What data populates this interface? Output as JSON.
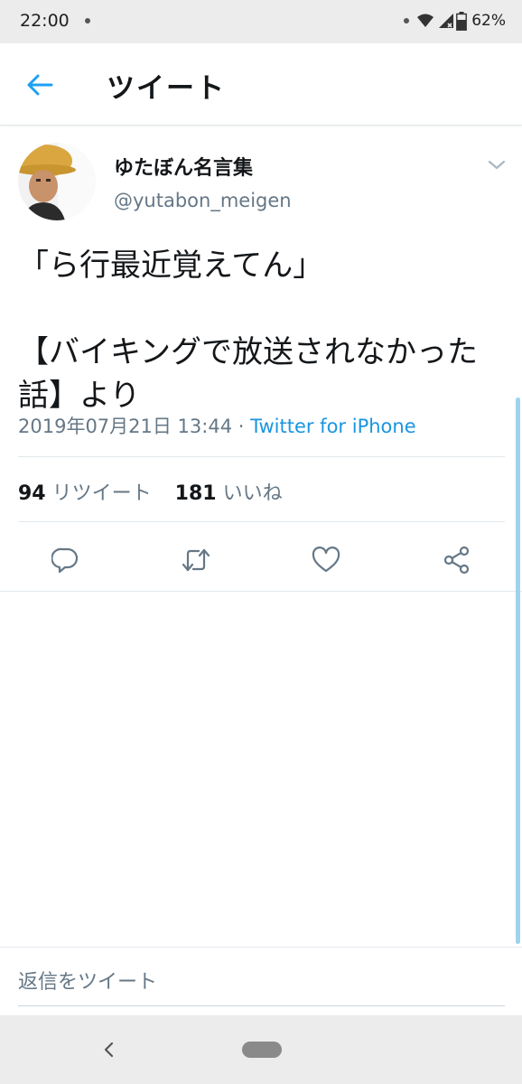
{
  "status_bar": {
    "time": "22:00",
    "battery": "62%",
    "icons": [
      "notification-dot-icon",
      "wifi-icon",
      "signal-icon",
      "battery-icon"
    ]
  },
  "header": {
    "title": "ツイート",
    "back_icon": "arrow-left-icon"
  },
  "tweet": {
    "display_name": "ゆたぼん名言集",
    "handle": "@yutabon_meigen",
    "text": "「ら行最近覚えてん」\n\n【バイキングで放送されなかった話】より",
    "timestamp": "2019年07月21日 13:44",
    "separator": " · ",
    "source": "Twitter for iPhone",
    "retweet_count": "94",
    "retweet_label": "リツイート",
    "like_count": "181",
    "like_label": "いいね",
    "actions": [
      "reply-icon",
      "retweet-icon",
      "like-icon",
      "share-icon"
    ]
  },
  "reply": {
    "placeholder": "返信をツイート"
  },
  "colors": {
    "accent": "#1DA1F2",
    "link": "#1B95E0",
    "secondary_text": "#657786",
    "divider": "#E1E8ED"
  }
}
